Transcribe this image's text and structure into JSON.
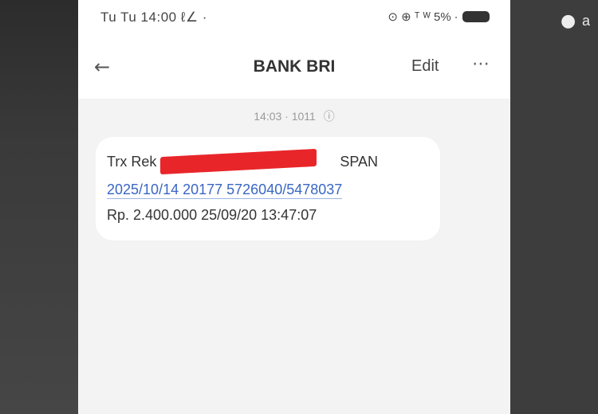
{
  "status_bar": {
    "time": "Tu Tu 14:00 ℓ∠ ·",
    "right_text": "⊙ ⊕ ᵀ ᵂ 5% ∙",
    "battery_icon": "battery-icon"
  },
  "header": {
    "back_icon": "←",
    "title": "BANK BRI",
    "edit_label": "Edit",
    "more_icon": "⋯"
  },
  "conversation": {
    "timestamp": "14:03 · 1011",
    "info_icon": "ⓘ"
  },
  "message": {
    "prefix": "Trx Rek",
    "redacted_account": "",
    "spn_label": "SPAN",
    "reference_link": "2025/10/14 20177 5726040/5478037",
    "amount_line": "Rp. 2.400.000 25/09/20 13:47:07"
  },
  "background": {
    "corner_icon": "tag-icon",
    "corner_glyph": "●",
    "corner_text": "a"
  },
  "colors": {
    "redaction": "#e8262a",
    "link": "#3a66c4",
    "phone_bg": "#f3f3f3",
    "bubble_bg": "#ffffff",
    "dark_bg": "#3f3f3f"
  }
}
